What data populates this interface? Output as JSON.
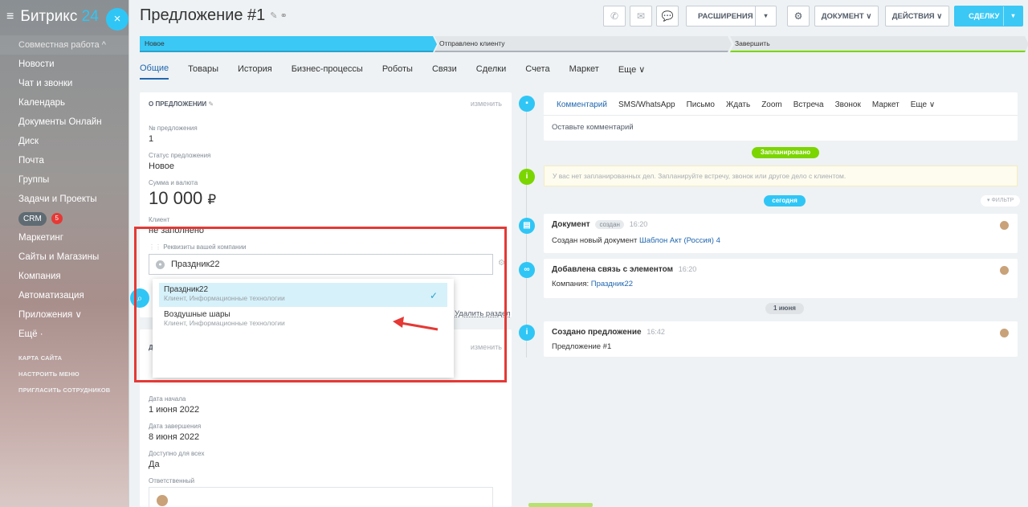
{
  "sidebar": {
    "logo_name": "Битрикс",
    "logo_num": "24",
    "items": [
      {
        "label": "Совместная работа ^"
      },
      {
        "label": "Новости"
      },
      {
        "label": "Чат и звонки"
      },
      {
        "label": "Календарь"
      },
      {
        "label": "Документы Онлайн"
      },
      {
        "label": "Диск"
      },
      {
        "label": "Почта"
      },
      {
        "label": "Группы"
      },
      {
        "label": "Задачи и Проекты"
      },
      {
        "label": "CRM",
        "badge": "5"
      },
      {
        "label": "Маркетинг"
      },
      {
        "label": "Сайты и Магазины"
      },
      {
        "label": "Компания"
      },
      {
        "label": "Автоматизация"
      },
      {
        "label": "Приложения ∨"
      },
      {
        "label": "Ещё ·"
      }
    ],
    "small_links": [
      "КАРТА САЙТА",
      "НАСТРОИТЬ МЕНЮ",
      "ПРИГЛАСИТЬ СОТРУДНИКОВ"
    ]
  },
  "header": {
    "title": "Предложение #1",
    "buttons": {
      "extensions": "РАСШИРЕНИЯ",
      "document": "ДОКУМЕНТ",
      "actions": "ДЕЙСТВИЯ",
      "deal": "СДЕЛКУ"
    }
  },
  "stages": [
    "Новое",
    "Отправлено клиенту",
    "Завершить"
  ],
  "tabs": [
    "Общие",
    "Товары",
    "История",
    "Бизнес-процессы",
    "Роботы",
    "Связи",
    "Сделки",
    "Счета",
    "Маркет",
    "Еще ∨"
  ],
  "about": {
    "section_title": "О ПРЕДЛОЖЕНИИ",
    "change": "изменить",
    "number_label": "№ предложения",
    "number_value": "1",
    "status_label": "Статус предложения",
    "status_value": "Новое",
    "sum_label": "Сумма и валюта",
    "sum_value": "10 000",
    "currency": "₽",
    "client_label": "Клиент",
    "client_value": "не заполнено",
    "requisites_label": "Реквизиты вашей компании",
    "requisites_value": "Праздник22",
    "delete_section": "Удалить раздел",
    "date_start_label": "Дата начала",
    "date_start_value": "1 июня 2022",
    "date_end_label": "Дата завершения",
    "date_end_value": "8 июня 2022",
    "available_label": "Доступно для всех",
    "available_value": "Да",
    "responsible_label": "Ответственный",
    "second_change": "изменить",
    "second_title_letter": "Д"
  },
  "dropdown": [
    {
      "title": "Праздник22",
      "subtitle": "Клиент, Информационные технологии"
    },
    {
      "title": "Воздушные шары",
      "subtitle": "Клиент, Информационные технологии"
    }
  ],
  "timeline": {
    "tabs": [
      "Комментарий",
      "SMS/WhatsApp",
      "Письмо",
      "Ждать",
      "Zoom",
      "Встреча",
      "Звонок",
      "Маркет",
      "Еще ∨"
    ],
    "comment_placeholder": "Оставьте комментарий",
    "planned_pill": "Запланировано",
    "planned_note": "У вас нет запланированных дел. Запланируйте встречу, звонок или другое дело с клиентом.",
    "today_pill": "сегодня",
    "filter": "ФИЛЬТР",
    "june_pill": "1 июня",
    "entries": [
      {
        "title": "Документ",
        "tag": "создан",
        "time": "16:20",
        "text": "Создан новый документ",
        "link": "Шаблон Акт (Россия) 4"
      },
      {
        "title": "Добавлена связь с элементом",
        "time": "16:20",
        "text": "Компания:",
        "link": "Праздник22"
      },
      {
        "title": "Создано предложение",
        "time": "16:42",
        "text": "Предложение #1"
      }
    ]
  },
  "colors": {
    "accent": "#3bc8f5",
    "link": "#2067b0",
    "highlight": "#e53935",
    "success": "#7bd500"
  }
}
